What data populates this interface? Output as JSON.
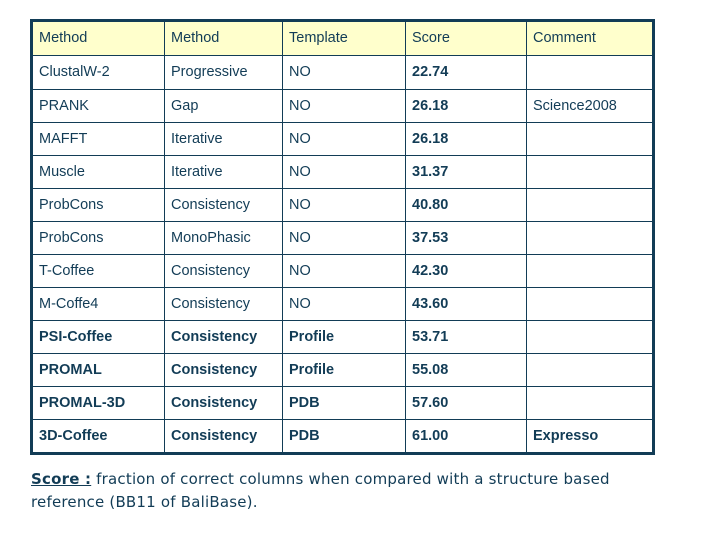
{
  "table": {
    "headers": [
      "Method",
      "Method",
      "Template",
      "Score",
      "Comment"
    ],
    "rows": [
      {
        "method": "ClustalW-2",
        "type": "Progressive",
        "template": "NO",
        "score": "22.74",
        "comment": "",
        "bold": false
      },
      {
        "method": "PRANK",
        "type": "Gap",
        "template": "NO",
        "score": "26.18",
        "comment": "Science2008",
        "bold": false
      },
      {
        "method": "MAFFT",
        "type": "Iterative",
        "template": "NO",
        "score": "26.18",
        "comment": "",
        "bold": false
      },
      {
        "method": "Muscle",
        "type": "Iterative",
        "template": "NO",
        "score": "31.37",
        "comment": "",
        "bold": false
      },
      {
        "method": "ProbCons",
        "type": "Consistency",
        "template": "NO",
        "score": "40.80",
        "comment": "",
        "bold": false
      },
      {
        "method": "ProbCons",
        "type": "MonoPhasic",
        "template": "NO",
        "score": "37.53",
        "comment": "",
        "bold": false
      },
      {
        "method": "T-Coffee",
        "type": "Consistency",
        "template": "NO",
        "score": "42.30",
        "comment": "",
        "bold": false
      },
      {
        "method": "M-Coffe4",
        "type": "Consistency",
        "template": "NO",
        "score": "43.60",
        "comment": "",
        "bold": false
      },
      {
        "method": "PSI-Coffee",
        "type": "Consistency",
        "template": "Profile",
        "score": "53.71",
        "comment": "",
        "bold": true
      },
      {
        "method": "PROMAL",
        "type": "Consistency",
        "template": "Profile",
        "score": "55.08",
        "comment": "",
        "bold": true
      },
      {
        "method": "PROMAL-3D",
        "type": "Consistency",
        "template": "PDB",
        "score": "57.60",
        "comment": "",
        "bold": true
      },
      {
        "method": "3D-Coffee",
        "type": "Consistency",
        "template": "PDB",
        "score": "61.00",
        "comment": "Expresso",
        "bold": true
      }
    ]
  },
  "caption": {
    "term": "Score :",
    "text": " fraction of correct columns when compared with a structure based reference (BB11 of BaliBase)."
  },
  "colors": {
    "header_background": "#ffffcc",
    "border": "#123c56",
    "text": "#123c56",
    "page_background": "#ffffff"
  }
}
